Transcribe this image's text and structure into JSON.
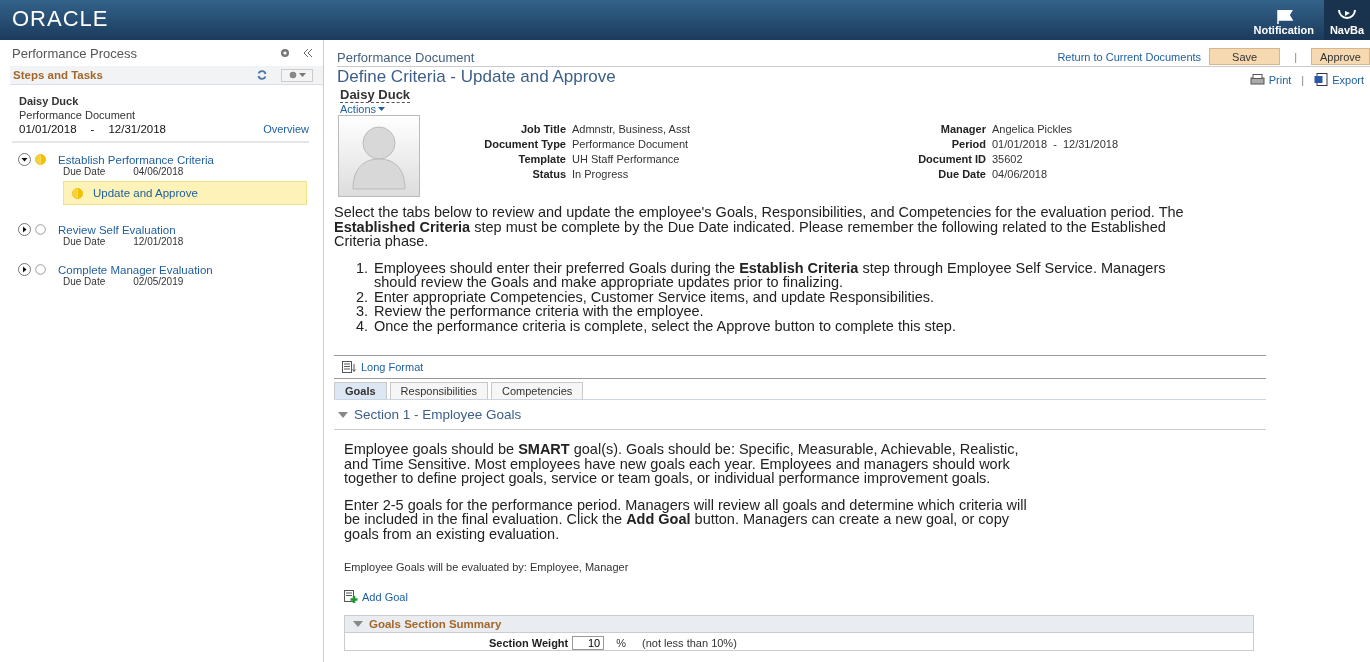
{
  "header": {
    "logo": "ORACLE",
    "actions": [
      {
        "label": "Notification",
        "kind": "flag"
      },
      {
        "label": "NavBa",
        "kind": "compass"
      }
    ]
  },
  "sidebar": {
    "title": "Performance Process",
    "section": "Steps and Tasks",
    "employee": "Daisy Duck",
    "document": "Performance Document",
    "period_start": "01/01/2018",
    "period_sep": "-",
    "period_end": "12/31/2018",
    "overview_link": "Overview",
    "steps": [
      {
        "label": "Establish Performance Criteria",
        "expanded": true,
        "kind": "started",
        "due_label": "Due Date",
        "due": "04/06/2018",
        "children": [
          {
            "label": "Update and Approve",
            "kind": "started",
            "selected": true
          }
        ]
      },
      {
        "label": "Review Self Evaluation",
        "expanded": false,
        "kind": "pending",
        "due_label": "Due Date",
        "due": "12/01/2018"
      },
      {
        "label": "Complete Manager Evaluation",
        "expanded": false,
        "kind": "pending",
        "due_label": "Due Date",
        "due": "02/05/2019"
      }
    ]
  },
  "main": {
    "breadcrumb": "Performance Document",
    "return_link": "Return to Current Documents",
    "buttons": [
      "Save",
      "Approve"
    ],
    "separator": "|",
    "title": "Define Criteria - Update and Approve",
    "print": "Print",
    "export": "Export",
    "employee": "Daisy Duck",
    "actions": "Actions",
    "details_left": [
      {
        "label": "Job Title",
        "value": "Admnstr, Business, Asst"
      },
      {
        "label": "Document Type",
        "value": "Performance Document"
      },
      {
        "label": "Template",
        "value": "UH Staff Performance"
      },
      {
        "label": "Status",
        "value": "In Progress"
      }
    ],
    "details_right": [
      {
        "label": "Manager",
        "value": "Angelica Pickles"
      },
      {
        "label": "Period",
        "value": "01/01/2018  -  12/31/2018"
      },
      {
        "label": "Document ID",
        "value": "35602"
      },
      {
        "label": "Due Date",
        "value": "04/06/2018"
      }
    ],
    "intro": "Select the tabs below to review and update the employee's Goals, Responsibilities, and Competencies for the evaluation period. The **Established Criteria** step must be complete by the Due Date indicated. Please remember the following related to the Established Criteria phase.",
    "instructions": [
      {
        "number": "1.",
        "text": "Employees should enter their preferred Goals during the **Establish Criteria** step through Employee Self Service. Managers should review the Goals and make appropriate updates prior to finalizing."
      },
      {
        "number": "2.",
        "text": "Enter appropriate Competencies, Customer Service items, and update Responsibilities."
      },
      {
        "number": "3.",
        "text": "Review the performance criteria with the employee."
      },
      {
        "number": "4.",
        "text": "Once the performance criteria is complete, select the Approve button to complete this step."
      }
    ],
    "long_format": "Long Format",
    "tabs": [
      {
        "label": "Goals",
        "selected": true
      },
      {
        "label": "Responsibilities",
        "selected": false
      },
      {
        "label": "Competencies",
        "selected": false
      }
    ],
    "section_title": "Section 1 - Employee Goals",
    "section_expanded": true,
    "section_paragraphs": [
      "Employee goals should be **SMART** goal(s). Goals should be: Specific, Measurable, Achievable, Realistic, and Time Sensitive. Most employees have new goals each year. Employees and managers should work together to define project goals, service or team goals, or individual performance improvement goals.",
      "Enter 2-5 goals for the performance period. Managers will review all goals and determine which criteria will be included in the final evaluation. Click the **Add Goal** button. Managers can create a new goal, or copy goals from an existing evaluation."
    ],
    "evaluated_by": "Employee Goals will be evaluated by: Employee, Manager",
    "add_goal": "Add Goal",
    "summary": {
      "title": "Goals Section Summary",
      "expanded": true,
      "weight_label": "Section Weight",
      "weight_value": "10",
      "unit": "%",
      "note": "(not less than 10%)"
    }
  }
}
